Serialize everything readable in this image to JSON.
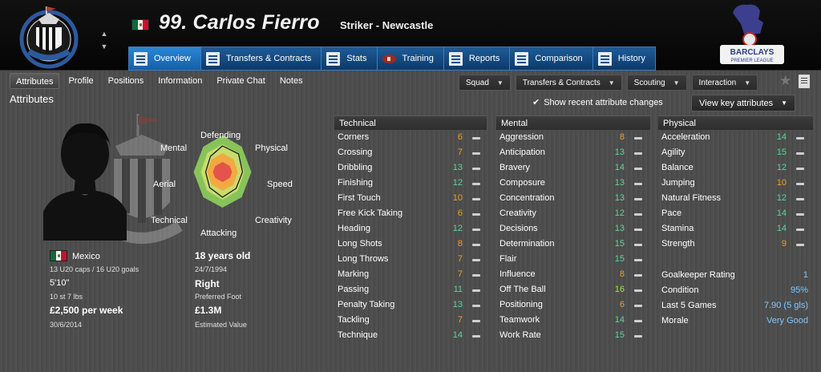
{
  "header": {
    "club_crest_text": "NEWCASTLE UNITED",
    "player_title": "99. Carlos Fierro",
    "player_sub": "Striker - Newcastle",
    "league_logo_text": "BARCLAYS PREMIER LEAGUE",
    "nav_up_icon": "triangle-up",
    "nav_down_icon": "triangle-down"
  },
  "tabs": [
    {
      "label": "Overview",
      "icon": "overview-icon",
      "active": true
    },
    {
      "label": "Transfers & Contracts",
      "icon": "contract-icon"
    },
    {
      "label": "Stats",
      "icon": "stats-icon"
    },
    {
      "label": "Training",
      "icon": "ball-icon"
    },
    {
      "label": "Reports",
      "icon": "report-icon"
    },
    {
      "label": "Comparison",
      "icon": "compare-icon"
    },
    {
      "label": "History",
      "icon": "history-icon"
    }
  ],
  "subnav": [
    "Attributes",
    "Profile",
    "Positions",
    "Information",
    "Private Chat",
    "Notes"
  ],
  "dropdowns": [
    "Squad",
    "Transfers & Contracts",
    "Scouting",
    "Interaction"
  ],
  "section_title": "Attributes",
  "show_changes_label": "Show recent attribute changes",
  "view_key_label": "View key attributes",
  "radar": {
    "labels": {
      "defending": "Defending",
      "mental": "Mental",
      "physical": "Physical",
      "aerial": "Aerial",
      "speed": "Speed",
      "technical": "Technical",
      "creativity": "Creativity",
      "attacking": "Attacking"
    }
  },
  "info": {
    "nationality": "Mexico",
    "caps": "13 U20 caps / 16 U20 goals",
    "height": "5'10\"",
    "weight": "10 st 7 lbs",
    "wage": "£2,500 per week",
    "contract_end": "30/6/2014",
    "age": "18 years old",
    "dob": "24/7/1994",
    "foot": "Right",
    "foot_label": "Preferred Foot",
    "value": "£1.3M",
    "value_label": "Estimated Value"
  },
  "technical": {
    "header": "Technical",
    "rows": [
      {
        "name": "Corners",
        "value": "6",
        "color": "#f0a020"
      },
      {
        "name": "Crossing",
        "value": "7",
        "color": "#f0a020"
      },
      {
        "name": "Dribbling",
        "value": "13",
        "color": "#5fd49a"
      },
      {
        "name": "Finishing",
        "value": "12",
        "color": "#5fd49a"
      },
      {
        "name": "First Touch",
        "value": "10",
        "color": "#f0a020"
      },
      {
        "name": "Free Kick Taking",
        "value": "6",
        "color": "#f0a020"
      },
      {
        "name": "Heading",
        "value": "12",
        "color": "#5fd49a"
      },
      {
        "name": "Long Shots",
        "value": "8",
        "color": "#f0a020"
      },
      {
        "name": "Long Throws",
        "value": "7",
        "color": "#f0a020"
      },
      {
        "name": "Marking",
        "value": "7",
        "color": "#f0a020"
      },
      {
        "name": "Passing",
        "value": "11",
        "color": "#5fd49a"
      },
      {
        "name": "Penalty Taking",
        "value": "13",
        "color": "#5fd49a"
      },
      {
        "name": "Tackling",
        "value": "7",
        "color": "#f0a020"
      },
      {
        "name": "Technique",
        "value": "14",
        "color": "#5fd49a"
      }
    ]
  },
  "mental": {
    "header": "Mental",
    "rows": [
      {
        "name": "Aggression",
        "value": "8",
        "color": "#f0a020"
      },
      {
        "name": "Anticipation",
        "value": "13",
        "color": "#5fd49a"
      },
      {
        "name": "Bravery",
        "value": "14",
        "color": "#5fd49a"
      },
      {
        "name": "Composure",
        "value": "13",
        "color": "#5fd49a"
      },
      {
        "name": "Concentration",
        "value": "13",
        "color": "#5fd49a"
      },
      {
        "name": "Creativity",
        "value": "12",
        "color": "#5fd49a"
      },
      {
        "name": "Decisions",
        "value": "13",
        "color": "#5fd49a"
      },
      {
        "name": "Determination",
        "value": "15",
        "color": "#5fd49a"
      },
      {
        "name": "Flair",
        "value": "15",
        "color": "#5fd49a"
      },
      {
        "name": "Influence",
        "value": "8",
        "color": "#f0a020"
      },
      {
        "name": "Off The Ball",
        "value": "16",
        "color": "#8ef03a"
      },
      {
        "name": "Positioning",
        "value": "6",
        "color": "#f0a020"
      },
      {
        "name": "Teamwork",
        "value": "14",
        "color": "#5fd49a"
      },
      {
        "name": "Work Rate",
        "value": "15",
        "color": "#5fd49a"
      }
    ]
  },
  "physical": {
    "header": "Physical",
    "rows": [
      {
        "name": "Acceleration",
        "value": "14",
        "color": "#5fd49a"
      },
      {
        "name": "Agility",
        "value": "15",
        "color": "#5fd49a"
      },
      {
        "name": "Balance",
        "value": "12",
        "color": "#5fd49a"
      },
      {
        "name": "Jumping",
        "value": "10",
        "color": "#f0a020"
      },
      {
        "name": "Natural Fitness",
        "value": "12",
        "color": "#5fd49a"
      },
      {
        "name": "Pace",
        "value": "14",
        "color": "#5fd49a"
      },
      {
        "name": "Stamina",
        "value": "14",
        "color": "#5fd49a"
      },
      {
        "name": "Strength",
        "value": "9",
        "color": "#f0a020"
      }
    ]
  },
  "extra": {
    "goalkeeper_label": "Goalkeeper Rating",
    "goalkeeper_value": "1",
    "condition_label": "Condition",
    "condition_value": "95%",
    "last5_label": "Last 5 Games",
    "last5_value": "7.90 (5 gls)",
    "morale_label": "Morale",
    "morale_value": "Very Good"
  }
}
